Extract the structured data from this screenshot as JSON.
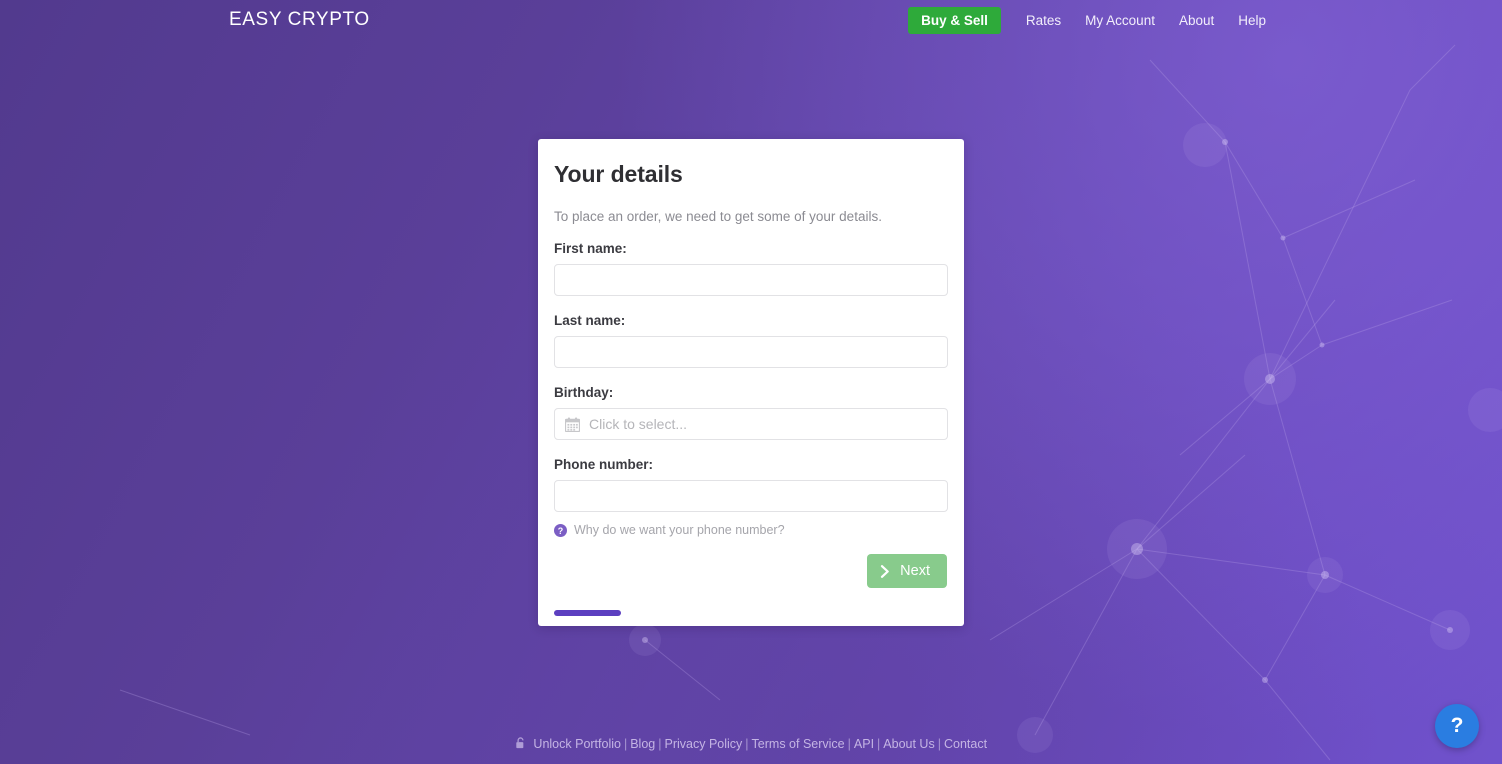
{
  "header": {
    "brand": "EASY CRYPTO",
    "nav": [
      {
        "label": "Buy & Sell",
        "cta": true
      },
      {
        "label": "Rates",
        "cta": false
      },
      {
        "label": "My Account",
        "cta": false
      },
      {
        "label": "About",
        "cta": false
      },
      {
        "label": "Help",
        "cta": false
      }
    ]
  },
  "card": {
    "title": "Your details",
    "subtitle": "To place an order, we need to get some of your details.",
    "fields": {
      "first_name": {
        "label": "First name:",
        "value": "",
        "placeholder": ""
      },
      "last_name": {
        "label": "Last name:",
        "value": "",
        "placeholder": ""
      },
      "birthday": {
        "label": "Birthday:",
        "value": "",
        "placeholder": "Click to select...",
        "icon": "calendar-icon"
      },
      "phone": {
        "label": "Phone number:",
        "value": "",
        "placeholder": ""
      }
    },
    "why_phone": {
      "icon": "question-circle-icon",
      "label": "Why do we want your phone number?"
    },
    "next_button": {
      "label": "Next",
      "icon": "chevron-right-icon",
      "color": "#88cb8c"
    },
    "progress": {
      "percent": 17
    }
  },
  "footer": {
    "lock_icon": "unlock-icon",
    "links": [
      "Unlock Portfolio",
      "Blog",
      "Privacy Policy",
      "Terms of Service",
      "API",
      "About Us",
      "Contact"
    ],
    "separator": "|"
  },
  "help_fab": {
    "icon": "question-mark-icon",
    "label": "?",
    "color": "#2a7de1"
  },
  "theme": {
    "background_dark": "#523a8e",
    "background_light": "#7052cc",
    "accent_green": "#2eaa3a",
    "accent_purple": "#5c3fc0"
  }
}
